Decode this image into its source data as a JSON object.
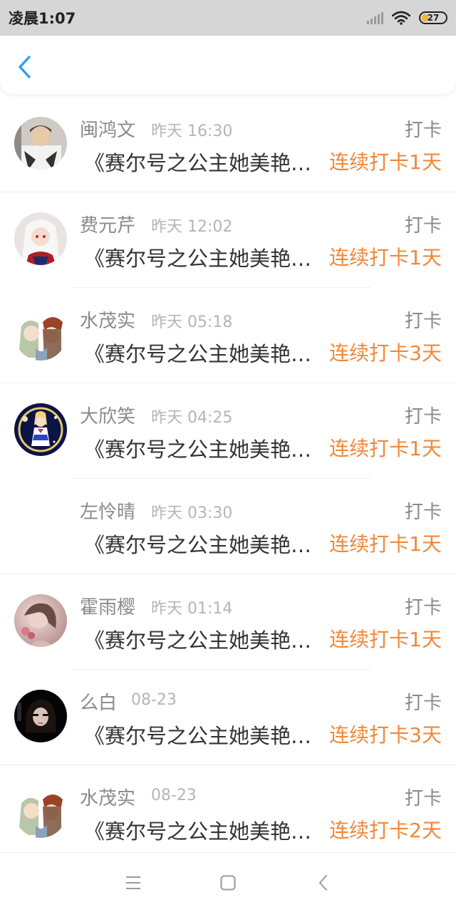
{
  "status_bar": {
    "time": "凌晨1:07",
    "battery": "27",
    "battery_level": 0.27,
    "icons": [
      "signal-icon",
      "wifi-icon",
      "battery-icon"
    ]
  },
  "header": {
    "back_icon": "chevron-left-icon",
    "accent": "#2e9ef2"
  },
  "list": {
    "items": [
      {
        "name": "闽鸿文",
        "time": "昨天 16:30",
        "tag": "打卡",
        "title": "《赛尔号之公主她美艳…",
        "streak": "连续打卡1天",
        "avatar": "avatar-photo-boy"
      },
      {
        "name": "费元芹",
        "time": "昨天 12:02",
        "tag": "打卡",
        "title": "《赛尔号之公主她美艳…",
        "streak": "连续打卡1天",
        "avatar": "avatar-anime-white-hair"
      },
      {
        "name": "水茂实",
        "time": "昨天 05:18",
        "tag": "打卡",
        "title": "《赛尔号之公主她美艳…",
        "streak": "连续打卡3天",
        "avatar": "avatar-anime-couple"
      },
      {
        "name": "大欣笑",
        "time": "昨天 04:25",
        "tag": "打卡",
        "title": "《赛尔号之公主她美艳…",
        "streak": "连续打卡1天",
        "avatar": "avatar-anime-moon"
      },
      {
        "name": "左怜晴",
        "time": "昨天 03:30",
        "tag": "打卡",
        "title": "《赛尔号之公主她美艳…",
        "streak": "连续打卡1天",
        "avatar": ""
      },
      {
        "name": "霍雨樱",
        "time": "昨天 01:14",
        "tag": "打卡",
        "title": "《赛尔号之公主她美艳…",
        "streak": "连续打卡1天",
        "avatar": "avatar-photo-pink"
      },
      {
        "name": "么白",
        "time": "08-23",
        "tag": "打卡",
        "title": "《赛尔号之公主她美艳…",
        "streak": "连续打卡3天",
        "avatar": "avatar-photo-dark"
      },
      {
        "name": "水茂实",
        "time": "08-23",
        "tag": "打卡",
        "title": "《赛尔号之公主她美艳…",
        "streak": "连续打卡2天",
        "avatar": "avatar-anime-couple"
      }
    ]
  },
  "nav_bar": {
    "icons": [
      "menu-icon",
      "home-icon",
      "back-icon"
    ]
  },
  "colors": {
    "streak": "#f0883a",
    "name": "#8a8a8a",
    "time": "#b5b5b5",
    "title": "#333333"
  }
}
